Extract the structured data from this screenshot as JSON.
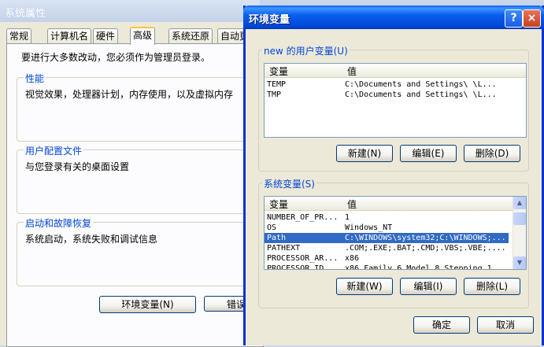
{
  "system_properties": {
    "title": "系统属性",
    "tabs": [
      "常规",
      "计算机名",
      "硬件",
      "高级",
      "系统还原",
      "自动更"
    ],
    "intro": "要进行大多数改动，您必须作为管理员登录。",
    "groups": [
      {
        "legend": "性能",
        "text": "视觉效果，处理器计划，内存使用，以及虚拟内存"
      },
      {
        "legend": "用户配置文件",
        "text": "与您登录有关的桌面设置"
      },
      {
        "legend": "启动和故障恢复",
        "text": "系统启动，系统失败和调试信息"
      }
    ],
    "env_button": "环境变量(N)",
    "error_button": "错误"
  },
  "env_dialog": {
    "title": "环境变量",
    "help_glyph": "?",
    "close_glyph": "×",
    "user_group_label": "new 的用户变量(U)",
    "col_var": "变量",
    "col_val": "值",
    "user_vars": [
      {
        "name": "TEMP",
        "value": "C:\\Documents and Settings\\   \\L..."
      },
      {
        "name": "TMP",
        "value": "C:\\Documents and Settings\\   \\L..."
      }
    ],
    "user_buttons": {
      "new": "新建(N)",
      "edit": "编辑(E)",
      "delete": "删除(D)"
    },
    "system_group_label": "系统变量(S)",
    "system_vars": [
      {
        "name": "NUMBER_OF_PR...",
        "value": "1"
      },
      {
        "name": "OS",
        "value": "Windows_NT"
      },
      {
        "name": "Path",
        "value": "C:\\WINDOWS\\system32;C:\\WINDOWS;..."
      },
      {
        "name": "PATHEXT",
        "value": ".COM;.EXE;.BAT;.CMD;.VBS;.VBE;...."
      },
      {
        "name": "PROCESSOR_AR...",
        "value": "x86"
      },
      {
        "name": "PROCESSOR_ID...",
        "value": "x86 Family 6 Model 8 Stepping 1"
      }
    ],
    "system_buttons": {
      "new": "新建(W)",
      "edit": "编辑(I)",
      "delete": "删除(L)"
    },
    "ok": "确定",
    "cancel": "取消"
  }
}
